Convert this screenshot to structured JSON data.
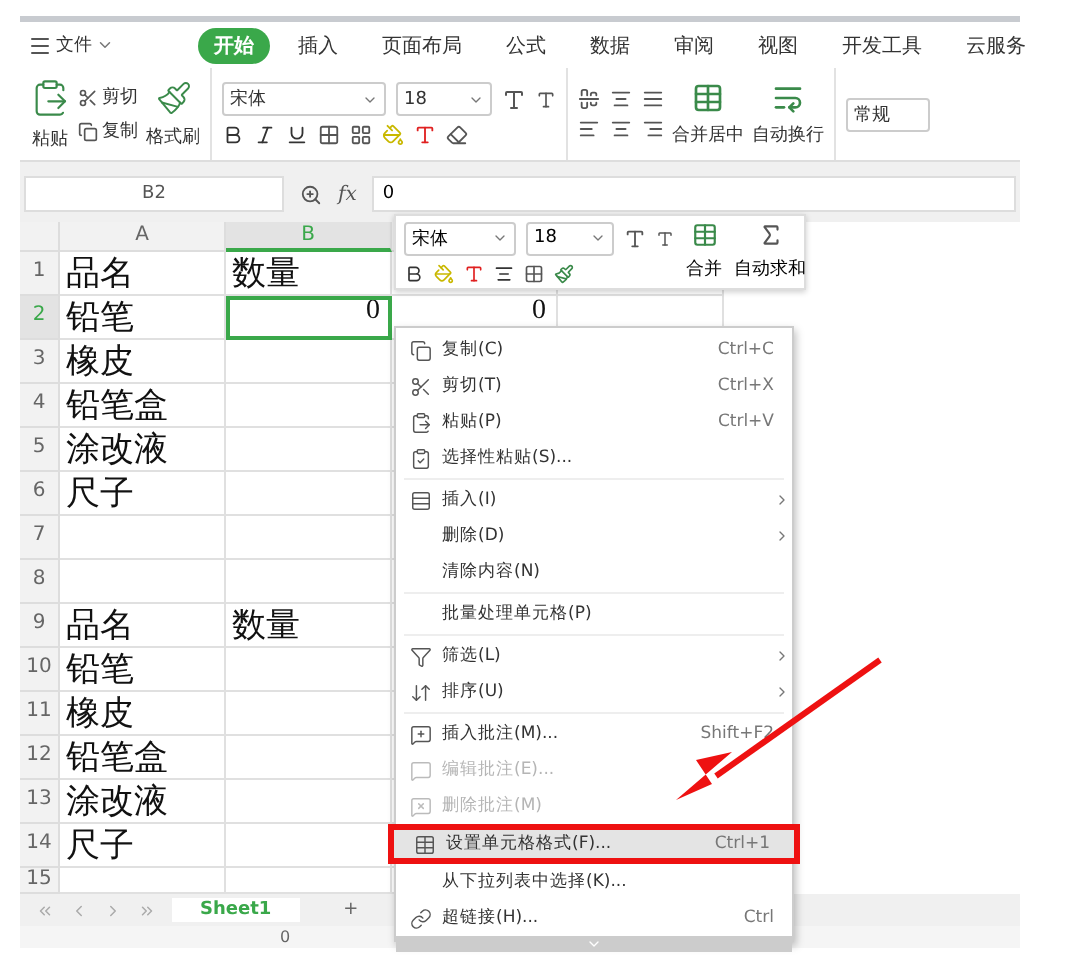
{
  "menu_bar": {
    "file": "文件",
    "tabs": [
      {
        "label": "开始",
        "selected": true
      },
      {
        "label": "插入",
        "selected": false
      },
      {
        "label": "页面布局",
        "selected": false
      },
      {
        "label": "公式",
        "selected": false
      },
      {
        "label": "数据",
        "selected": false
      },
      {
        "label": "审阅",
        "selected": false
      },
      {
        "label": "视图",
        "selected": false
      },
      {
        "label": "开发工具",
        "selected": false
      },
      {
        "label": "云服务",
        "selected": false
      }
    ]
  },
  "ribbon": {
    "paste": "粘贴",
    "cut": "剪切",
    "copy": "复制",
    "format_painter": "格式刷",
    "font": "宋体",
    "size": "18",
    "merge": "合并居中",
    "wrap": "自动换行",
    "number_format": "常规"
  },
  "formula_bar": {
    "cell_ref": "B2",
    "fx": "fx",
    "value": "0"
  },
  "columns": [
    {
      "label": "A",
      "selected": false
    },
    {
      "label": "B",
      "selected": true
    }
  ],
  "rows": [
    {
      "number": "1",
      "selected": false,
      "cells": [
        "品名",
        "数量"
      ]
    },
    {
      "number": "2",
      "selected": true,
      "cells": [
        "铅笔",
        "0",
        "0"
      ]
    },
    {
      "number": "3",
      "selected": false,
      "cells": [
        "橡皮",
        ""
      ]
    },
    {
      "number": "4",
      "selected": false,
      "cells": [
        "铅笔盒",
        ""
      ]
    },
    {
      "number": "5",
      "selected": false,
      "cells": [
        "涂改液",
        ""
      ]
    },
    {
      "number": "6",
      "selected": false,
      "cells": [
        "尺子",
        ""
      ]
    },
    {
      "number": "7",
      "selected": false,
      "cells": [
        "",
        ""
      ]
    },
    {
      "number": "8",
      "selected": false,
      "cells": [
        "",
        ""
      ]
    },
    {
      "number": "9",
      "selected": false,
      "cells": [
        "品名",
        "数量"
      ]
    },
    {
      "number": "10",
      "selected": false,
      "cells": [
        "铅笔",
        ""
      ]
    },
    {
      "number": "11",
      "selected": false,
      "cells": [
        "橡皮",
        ""
      ]
    },
    {
      "number": "12",
      "selected": false,
      "cells": [
        "铅笔盒",
        ""
      ]
    },
    {
      "number": "13",
      "selected": false,
      "cells": [
        "涂改液",
        ""
      ]
    },
    {
      "number": "14",
      "selected": false,
      "cells": [
        "尺子",
        ""
      ]
    },
    {
      "number": "15",
      "selected": false,
      "cells": [
        "",
        ""
      ]
    }
  ],
  "mini_toolbar": {
    "font": "宋体",
    "size": "18",
    "merge": "合并",
    "autosum": "自动求和"
  },
  "context_menu": {
    "items": [
      {
        "kind": "item",
        "label": "复制(C)",
        "shortcut": "Ctrl+C",
        "submenu": false,
        "disabled": false,
        "highlighted": false
      },
      {
        "kind": "item",
        "label": "剪切(T)",
        "shortcut": "Ctrl+X",
        "submenu": false,
        "disabled": false,
        "highlighted": false
      },
      {
        "kind": "item",
        "label": "粘贴(P)",
        "shortcut": "Ctrl+V",
        "submenu": false,
        "disabled": false,
        "highlighted": false
      },
      {
        "kind": "item",
        "label": "选择性粘贴(S)...",
        "submenu": false,
        "disabled": false,
        "highlighted": false
      },
      {
        "kind": "separator"
      },
      {
        "kind": "item",
        "label": "插入(I)",
        "submenu": true,
        "disabled": false,
        "highlighted": false
      },
      {
        "kind": "item",
        "label": "删除(D)",
        "submenu": true,
        "disabled": false,
        "highlighted": false
      },
      {
        "kind": "item",
        "label": "清除内容(N)",
        "submenu": false,
        "disabled": false,
        "highlighted": false
      },
      {
        "kind": "separator"
      },
      {
        "kind": "item",
        "label": "批量处理单元格(P)",
        "submenu": false,
        "disabled": false,
        "highlighted": false
      },
      {
        "kind": "separator"
      },
      {
        "kind": "item",
        "label": "筛选(L)",
        "submenu": true,
        "disabled": false,
        "highlighted": false
      },
      {
        "kind": "item",
        "label": "排序(U)",
        "submenu": true,
        "disabled": false,
        "highlighted": false
      },
      {
        "kind": "separator"
      },
      {
        "kind": "item",
        "label": "插入批注(M)...",
        "shortcut": "Shift+F2",
        "submenu": false,
        "disabled": false,
        "highlighted": false
      },
      {
        "kind": "item",
        "label": "编辑批注(E)...",
        "submenu": false,
        "disabled": true,
        "highlighted": false
      },
      {
        "kind": "item",
        "label": "删除批注(M)",
        "submenu": false,
        "disabled": true,
        "highlighted": false
      },
      {
        "kind": "item",
        "label": "设置单元格格式(F)...",
        "shortcut": "Ctrl+1",
        "submenu": false,
        "disabled": false,
        "highlighted": true
      },
      {
        "kind": "item",
        "label": "从下拉列表中选择(K)...",
        "submenu": false,
        "disabled": false,
        "highlighted": false
      },
      {
        "kind": "item",
        "label": "超链接(H)...",
        "shortcut": "Ctrl",
        "submenu": false,
        "disabled": false,
        "highlighted": false
      }
    ]
  },
  "sheet_tabs": [
    {
      "label": "Sheet1",
      "selected": true
    },
    {
      "label": "+",
      "selected": false
    }
  ],
  "status_bar": {
    "value": "0"
  }
}
